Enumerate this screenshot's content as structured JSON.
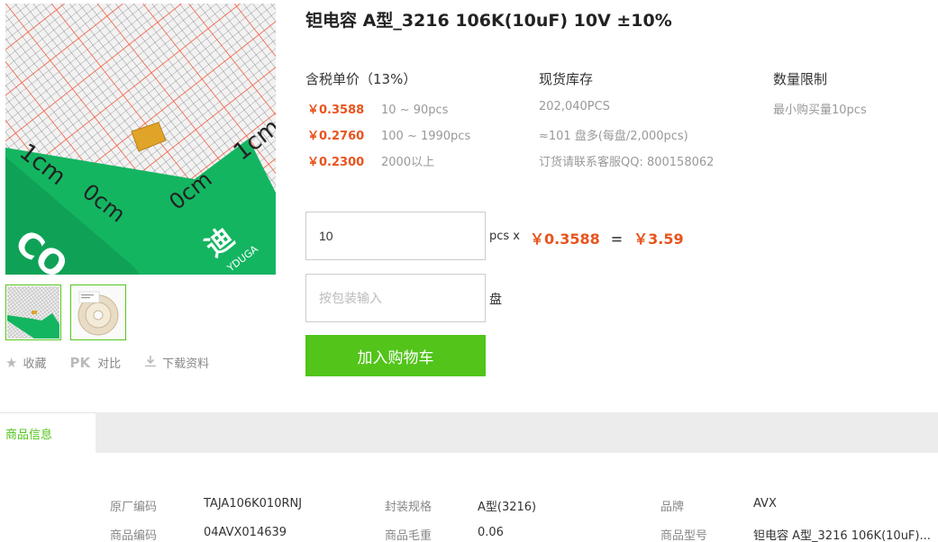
{
  "product": {
    "title": "钽电容 A型_3216 106K(10uF) 10V ±10%"
  },
  "image": {
    "ruler_text_1cm_left": "1cm",
    "ruler_text_0cm_left": "0cm",
    "ruler_text_0cm_right": "0cm",
    "ruler_text_1cm_right": "1cm",
    "brand_vertical": "CO",
    "brand_right": "迪",
    "brand_small": "YDUGA"
  },
  "actions": {
    "favorite_label": "收藏",
    "compare_pk": "PK",
    "compare_label": "对比",
    "download_label": "下载资料"
  },
  "pricing": {
    "header": "含税单价（13%）",
    "tiers": [
      {
        "price": "￥0.3588",
        "range": "10 ~ 90pcs"
      },
      {
        "price": "￥0.2760",
        "range": "100 ~ 1990pcs"
      },
      {
        "price": "￥0.2300",
        "range": "2000以上"
      }
    ]
  },
  "stock": {
    "header": "现货库存",
    "lines": [
      "202,040PCS",
      "≈101 盘多(每盘/2,000pcs)",
      "订货请联系客服QQ: 800158062"
    ]
  },
  "limit": {
    "header": "数量限制",
    "text": "最小购买量10pcs"
  },
  "order": {
    "quantity_value": "10",
    "pcs_x": "pcs x",
    "unit_price": "￥0.3588",
    "equals": "=",
    "total": "￥3.59",
    "package_placeholder": "按包装输入",
    "package_unit": "盘",
    "add_to_cart": "加入购物车"
  },
  "tabs": {
    "active": "商品信息"
  },
  "details": {
    "rows": [
      [
        {
          "key": "原厂编码",
          "value": "TAJA106K010RNJ"
        },
        {
          "key": "封装规格",
          "value": "A型(3216)"
        },
        {
          "key": "品牌",
          "value": "AVX"
        }
      ],
      [
        {
          "key": "商品编码",
          "value": "04AVX014639"
        },
        {
          "key": "商品毛重",
          "value": "0.06"
        },
        {
          "key": "商品型号",
          "value": "钽电容 A型_3216 106K(10uF)..."
        }
      ]
    ]
  },
  "colors": {
    "accent_green": "#52c41a",
    "price_orange": "#e8541e"
  }
}
